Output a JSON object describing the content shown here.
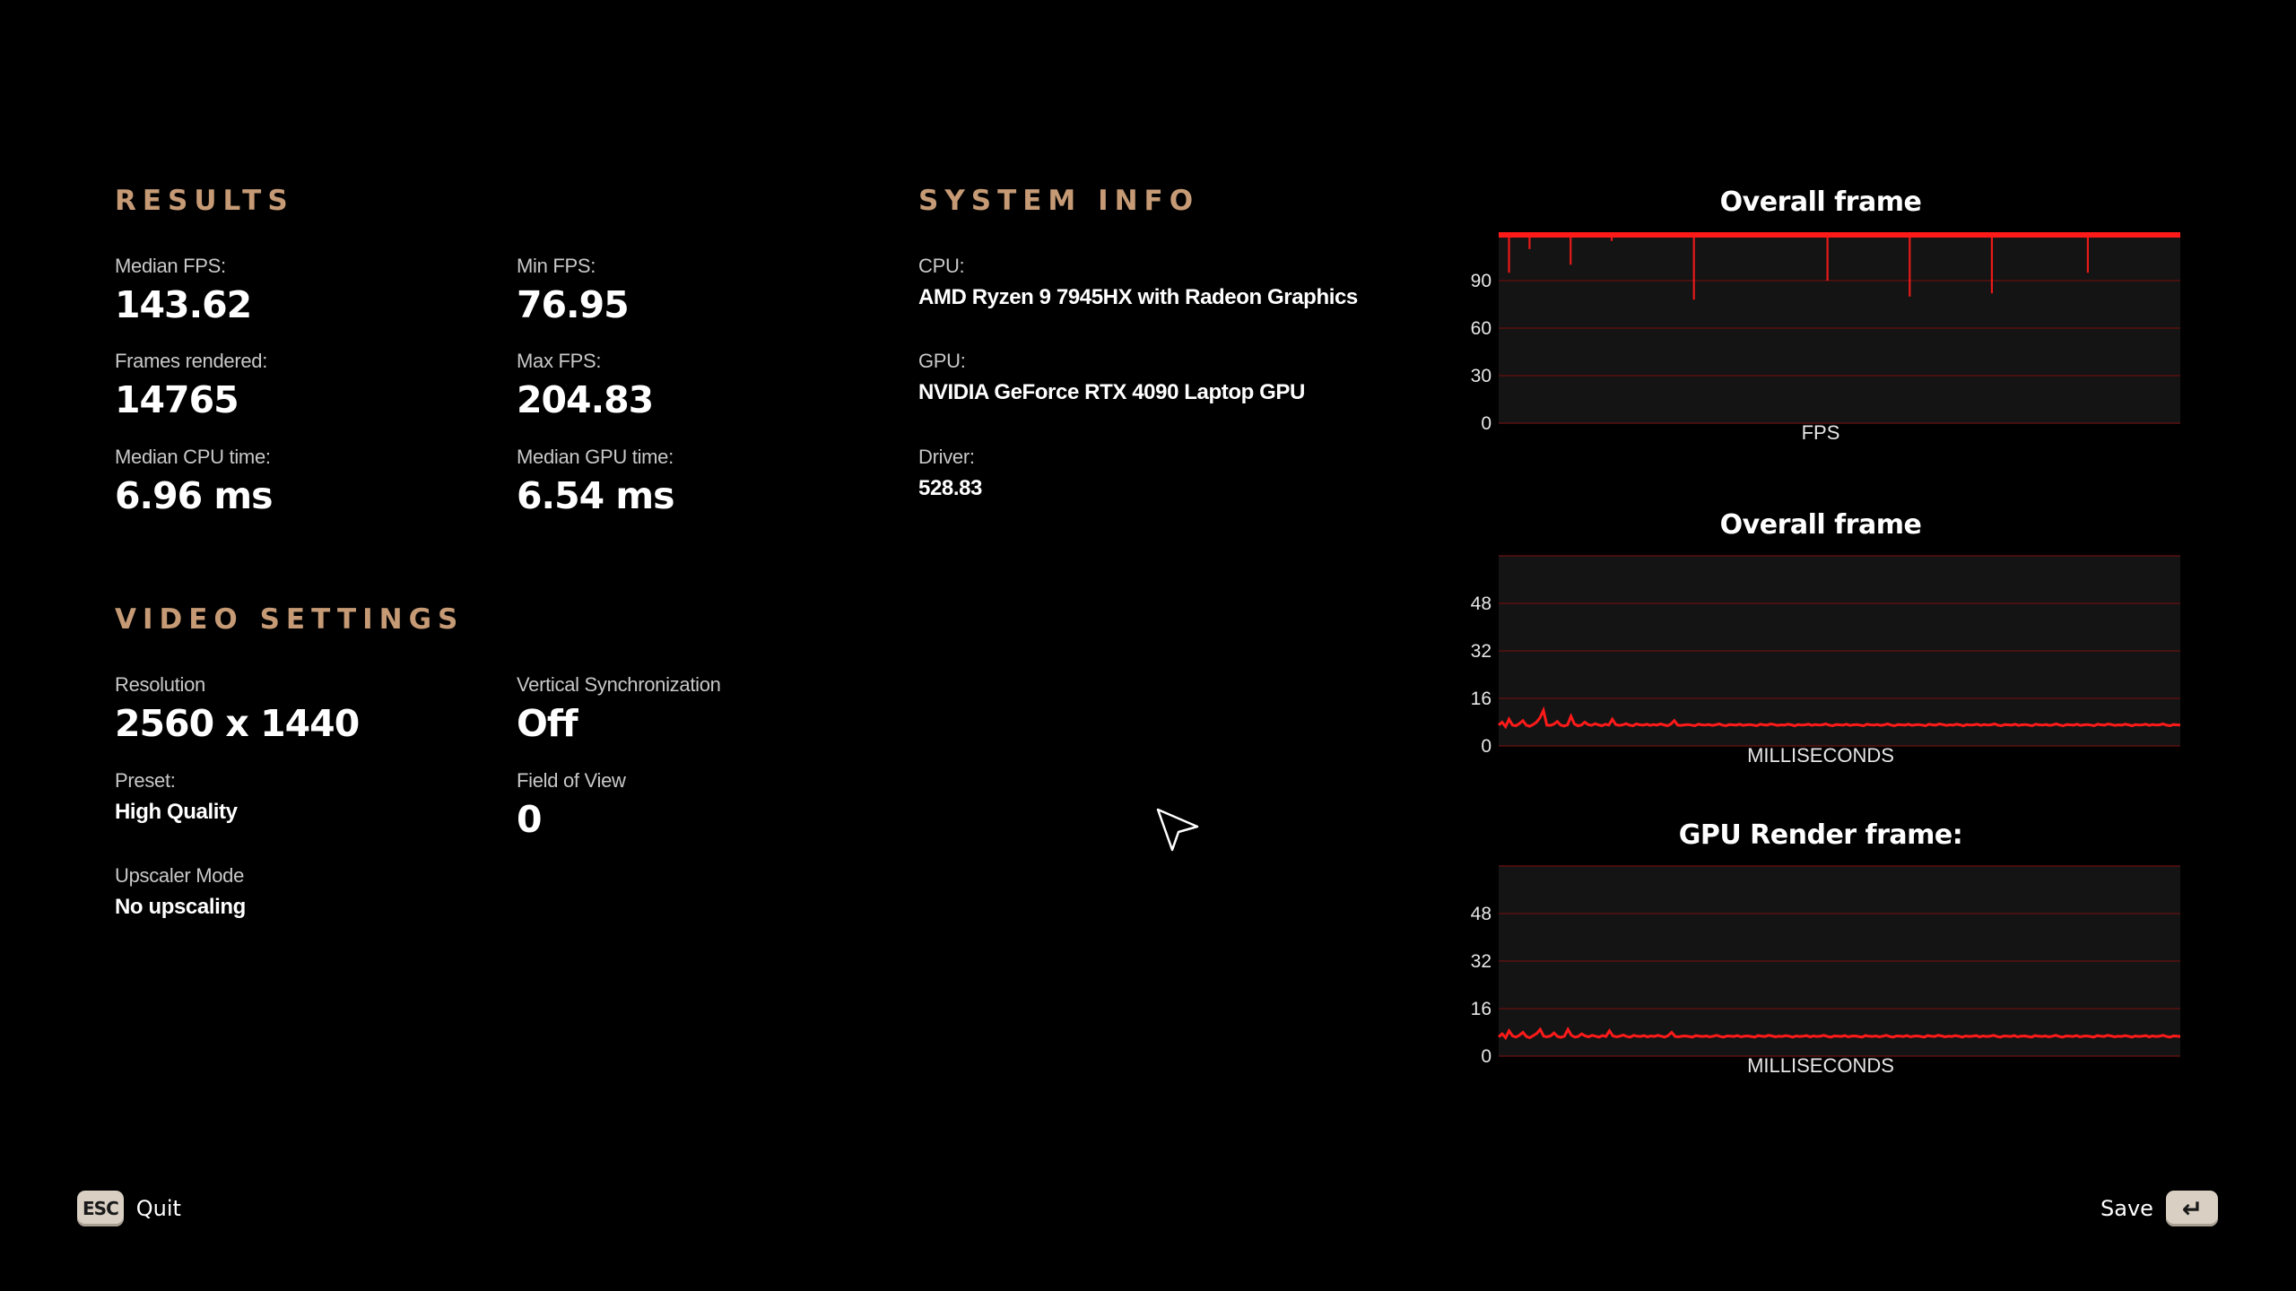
{
  "results": {
    "title": "RESULTS",
    "median_fps": {
      "label": "Median FPS:",
      "value": "143.62"
    },
    "min_fps": {
      "label": "Min FPS:",
      "value": "76.95"
    },
    "frames_rendered": {
      "label": "Frames rendered:",
      "value": "14765"
    },
    "max_fps": {
      "label": "Max FPS:",
      "value": "204.83"
    },
    "median_cpu": {
      "label": "Median CPU time:",
      "value": "6.96 ms"
    },
    "median_gpu": {
      "label": "Median GPU time:",
      "value": "6.54 ms"
    }
  },
  "video": {
    "title": "VIDEO SETTINGS",
    "resolution": {
      "label": "Resolution",
      "value": "2560 x 1440"
    },
    "vsync": {
      "label": "Vertical Synchronization",
      "value": "Off"
    },
    "preset": {
      "label": "Preset:",
      "value": "High Quality"
    },
    "fov": {
      "label": "Field of View",
      "value": "0"
    },
    "upscaler": {
      "label": "Upscaler Mode",
      "value": "No upscaling"
    }
  },
  "system": {
    "title": "SYSTEM INFO",
    "cpu": {
      "label": "CPU:",
      "value": "AMD Ryzen 9 7945HX with Radeon Graphics"
    },
    "gpu": {
      "label": "GPU:",
      "value": "NVIDIA GeForce RTX 4090 Laptop GPU"
    },
    "driver": {
      "label": "Driver:",
      "value": "528.83"
    }
  },
  "footer": {
    "quit_key": "ESC",
    "quit_label": "Quit",
    "save_label": "Save",
    "save_key": "↵"
  },
  "colors": {
    "accent": "#c59a75",
    "series": "#ff1a1a",
    "grid": "#5a1010",
    "plot_bg": "#141414"
  },
  "chart_data": [
    {
      "type": "line",
      "title": "Overall frame",
      "xlabel": "FPS",
      "ylabel": "",
      "yticks": [
        0,
        30,
        60,
        90
      ],
      "ylim": [
        0,
        120
      ],
      "xlim": [
        0,
        14765
      ],
      "grid": true,
      "series": [
        {
          "values": [
            150,
            118,
            145,
            95,
            160,
            140,
            122,
            155,
            148,
            110,
            165,
            150,
            135,
            158,
            120,
            145,
            160,
            152,
            140,
            130,
            155,
            100,
            148,
            160,
            140,
            125,
            158,
            150,
            145,
            132,
            160,
            148,
            152,
            115,
            150,
            162,
            140,
            155,
            128,
            148,
            160,
            145,
            150,
            138,
            156,
            142,
            160,
            150,
            148,
            135,
            155,
            122,
            150,
            160,
            145,
            158,
            140,
            78,
            150,
            160,
            152,
            148,
            155,
            160,
            145,
            150,
            158,
            142,
            152,
            160,
            147,
            155,
            130,
            150,
            160,
            120,
            148,
            155,
            140,
            160,
            152,
            150,
            145,
            160,
            148,
            155,
            138,
            150,
            160,
            145,
            155,
            150,
            158,
            142,
            150,
            160,
            90,
            145,
            155,
            152,
            160,
            148,
            140,
            158,
            150,
            155,
            130,
            160,
            145,
            148,
            150,
            160,
            152,
            145,
            138,
            150,
            160,
            148,
            155,
            150,
            80,
            145,
            158,
            160,
            150,
            152,
            140,
            155,
            148,
            150,
            160,
            145,
            150,
            158,
            148,
            152,
            160,
            145,
            150,
            155,
            140,
            160,
            150,
            148,
            82,
            155,
            150,
            160,
            145,
            152,
            148,
            150,
            158,
            145,
            160,
            150,
            140,
            155,
            150,
            148,
            160,
            152,
            150,
            145,
            155,
            160,
            150,
            148,
            145,
            160,
            152,
            150,
            95,
            158,
            148,
            150,
            160,
            145,
            152,
            150,
            155,
            160,
            148,
            150,
            145,
            160,
            150,
            152,
            148,
            155,
            150,
            160,
            145,
            150,
            158,
            148,
            140,
            160,
            152,
            150
          ]
        }
      ]
    },
    {
      "type": "line",
      "title": "Overall frame",
      "xlabel": "MILLISECONDS",
      "ylabel": "",
      "yticks": [
        0,
        16,
        32,
        48
      ],
      "ylim": [
        0,
        64
      ],
      "xlim": [
        0,
        14765
      ],
      "grid": true,
      "series": [
        {
          "values": [
            7,
            8,
            6.5,
            9,
            7,
            6.8,
            7.5,
            8.5,
            7,
            6.6,
            7.2,
            8,
            9.5,
            12,
            7,
            6.9,
            7.3,
            8.2,
            7,
            6.7,
            7.1,
            10,
            7.4,
            6.8,
            7,
            8,
            7.2,
            6.9,
            7.5,
            7.1,
            6.8,
            7.3,
            7,
            9,
            7.2,
            6.9,
            7.1,
            7.5,
            7,
            6.8,
            7.4,
            7.1,
            7,
            7.3,
            6.9,
            7.2,
            7,
            7.4,
            7.1,
            6.8,
            7.3,
            8.5,
            7,
            6.9,
            7.1,
            7.2,
            7,
            6.8,
            7.3,
            7.1,
            7,
            7.2,
            6.9,
            7.1,
            7.4,
            7,
            6.8,
            7.2,
            7.1,
            7,
            7.3,
            6.9,
            7.1,
            7.2,
            7,
            6.8,
            7.3,
            7.1,
            7,
            7.4,
            7.2,
            6.9,
            7.1,
            7,
            7.3,
            7.1,
            6.8,
            7.2,
            7,
            7.1,
            7.3,
            6.9,
            7.2,
            7,
            7.1,
            7.4,
            7,
            6.8,
            7.2,
            7.1,
            7,
            7.3,
            6.9,
            7.1,
            7.2,
            7,
            6.8,
            7.3,
            7.1,
            7,
            7.2,
            6.9,
            7.1,
            7.4,
            7,
            6.8,
            7.2,
            7.1,
            7,
            7.3,
            6.9,
            7.1,
            7.2,
            7,
            6.8,
            7.3,
            7.1,
            7,
            7.4,
            7.2,
            6.9,
            7.1,
            7,
            7.3,
            7.1,
            6.8,
            7.2,
            7,
            7.1,
            7.3,
            6.9,
            7.2,
            7,
            7.1,
            7.4,
            7,
            6.8,
            7.2,
            7.1,
            7,
            7.3,
            6.9,
            7.1,
            7.2,
            7,
            6.8,
            7.3,
            7.1,
            7,
            7.2,
            6.9,
            7.1,
            7.4,
            7,
            6.8,
            7.2,
            7.1,
            7,
            7.3,
            6.9,
            7.1,
            7.2,
            7,
            6.8,
            7.3,
            7.1,
            7,
            7.4,
            7.2,
            6.9,
            7.1,
            7,
            7.3,
            7.1,
            6.8,
            7.2,
            7,
            7.1,
            7.3,
            6.9,
            7.2,
            7,
            7.1,
            7.4,
            7,
            6.8,
            7.2,
            7.1,
            7
          ]
        }
      ]
    },
    {
      "type": "line",
      "title": "GPU Render frame:",
      "xlabel": "MILLISECONDS",
      "ylabel": "",
      "yticks": [
        0,
        16,
        32,
        48
      ],
      "ylim": [
        0,
        64
      ],
      "xlim": [
        0,
        14765
      ],
      "grid": true,
      "series": [
        {
          "values": [
            6.5,
            7.5,
            6.2,
            8.5,
            6.8,
            6.4,
            7,
            8,
            6.6,
            6.2,
            6.9,
            7.6,
            9,
            6.7,
            6.5,
            6.8,
            7.8,
            6.6,
            6.3,
            6.7,
            9,
            7,
            6.4,
            6.6,
            7.5,
            6.8,
            6.5,
            7,
            6.7,
            6.4,
            6.9,
            6.6,
            8.5,
            6.8,
            6.5,
            6.7,
            7.1,
            6.6,
            6.4,
            7,
            6.7,
            6.6,
            6.9,
            6.5,
            6.8,
            6.6,
            7,
            6.7,
            6.4,
            6.9,
            8,
            6.6,
            6.5,
            6.7,
            6.8,
            6.6,
            6.4,
            6.9,
            6.7,
            6.6,
            6.8,
            6.5,
            6.7,
            7,
            6.6,
            6.4,
            6.8,
            6.7,
            6.6,
            6.9,
            6.5,
            6.7,
            6.8,
            6.6,
            6.4,
            6.9,
            6.7,
            6.6,
            7,
            6.8,
            6.5,
            6.7,
            6.6,
            6.9,
            6.7,
            6.4,
            6.8,
            6.6,
            6.7,
            6.9,
            6.5,
            6.8,
            6.6,
            6.7,
            7,
            6.6,
            6.4,
            6.8,
            6.7,
            6.6,
            6.9,
            6.5,
            6.7,
            6.8,
            6.6,
            6.4,
            6.9,
            6.7,
            6.6,
            6.8,
            6.5,
            6.7,
            7,
            6.6,
            6.4,
            6.8,
            6.7,
            6.6,
            6.9,
            6.5,
            6.7,
            6.8,
            6.6,
            6.4,
            6.9,
            6.7,
            6.6,
            7,
            6.8,
            6.5,
            6.7,
            6.6,
            6.9,
            6.7,
            6.4,
            6.8,
            6.6,
            6.7,
            6.9,
            6.5,
            6.8,
            6.6,
            6.7,
            7,
            6.6,
            6.4,
            6.8,
            6.7,
            6.6,
            6.9,
            6.5,
            6.7,
            6.8,
            6.6,
            6.4,
            6.9,
            6.7,
            6.6,
            6.8,
            6.5,
            6.7,
            7,
            6.6,
            6.4,
            6.8,
            6.7,
            6.6,
            6.9,
            6.5,
            6.7,
            6.8,
            6.6,
            6.4,
            6.9,
            6.7,
            6.6,
            7,
            6.8,
            6.5,
            6.7,
            6.6,
            6.9,
            6.7,
            6.4,
            6.8,
            6.6,
            6.7,
            6.9,
            6.5,
            6.8,
            6.6,
            6.7,
            7,
            6.6,
            6.4,
            6.8,
            6.7,
            6.6
          ]
        }
      ]
    }
  ]
}
